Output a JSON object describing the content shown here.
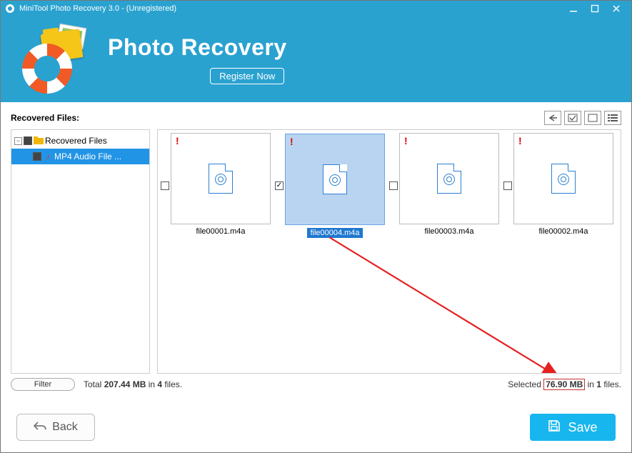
{
  "titlebar": {
    "title": "MiniTool Photo Recovery 3.0 - (Unregistered)"
  },
  "banner": {
    "title": "Photo Recovery",
    "register_label": "Register Now"
  },
  "section_label": "Recovered Files:",
  "tree": {
    "root_label": "Recovered Files",
    "child_label": "MP4 Audio File ..."
  },
  "thumbs": [
    {
      "name": "file00001.m4a",
      "selected": false
    },
    {
      "name": "file00004.m4a",
      "selected": true
    },
    {
      "name": "file00003.m4a",
      "selected": false
    },
    {
      "name": "file00002.m4a",
      "selected": false
    }
  ],
  "status": {
    "filter_label": "Filter",
    "total_prefix": "Total ",
    "total_size": "207.44 MB",
    "total_mid": " in ",
    "total_count": "4",
    "total_suffix": " files.",
    "selected_prefix": "Selected ",
    "selected_size": "76.90 MB",
    "selected_mid": " in ",
    "selected_count": "1",
    "selected_suffix": " files."
  },
  "buttons": {
    "back": "Back",
    "save": "Save"
  }
}
